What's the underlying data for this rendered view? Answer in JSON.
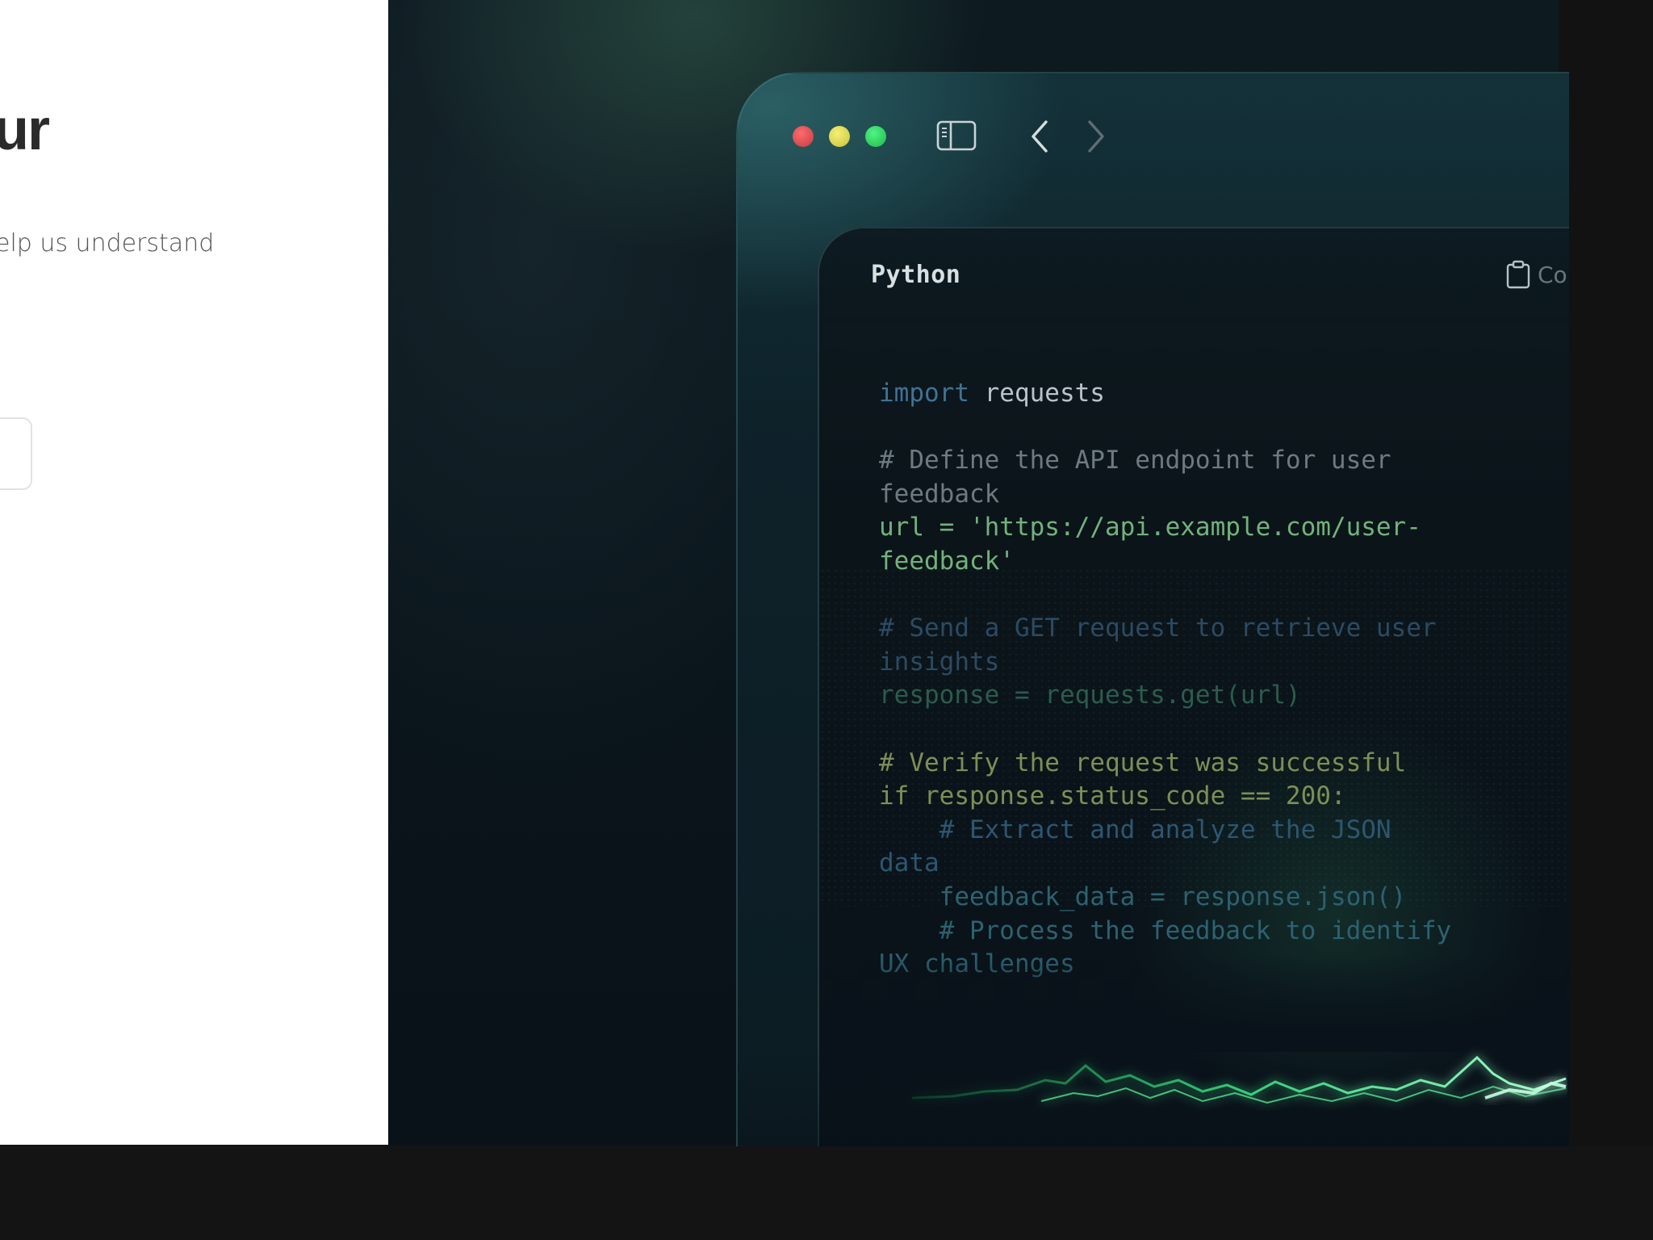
{
  "left_panel": {
    "title_fragment": "ur",
    "subtitle_fragment": "elp us understand"
  },
  "window": {
    "controls": {
      "close": "red-traffic-light",
      "minimize": "yellow-traffic-light",
      "maximize": "green-traffic-light"
    },
    "toolbar_icons": [
      "sidebar-toggle-icon",
      "chevron-left-icon",
      "chevron-right-icon"
    ]
  },
  "code_card": {
    "language": "Python",
    "copy_label": "Co",
    "lines": {
      "l1_kw": "import",
      "l1_rest": " requests",
      "l3": "# Define the API endpoint for user",
      "l4": "feedback",
      "l5": "url = 'https://api.example.com/user-",
      "l6": "feedback'",
      "l8": "# Send a GET request to retrieve user",
      "l9": "insights",
      "l10": "response = requests.get(url)",
      "l12": "# Verify the request was successful",
      "l13": "if response.status_code == 200:",
      "l14": "    # Extract and analyze the JSON",
      "l15": "data",
      "l16": "    feedback_data = response.json()",
      "l17": "    # Process the feedback to identify",
      "l18": "UX challenges"
    }
  },
  "colors": {
    "accent_green": "#2fe07a",
    "keyword": "#3f7393",
    "string": "#72b27c",
    "comment": "#6d7a80"
  }
}
